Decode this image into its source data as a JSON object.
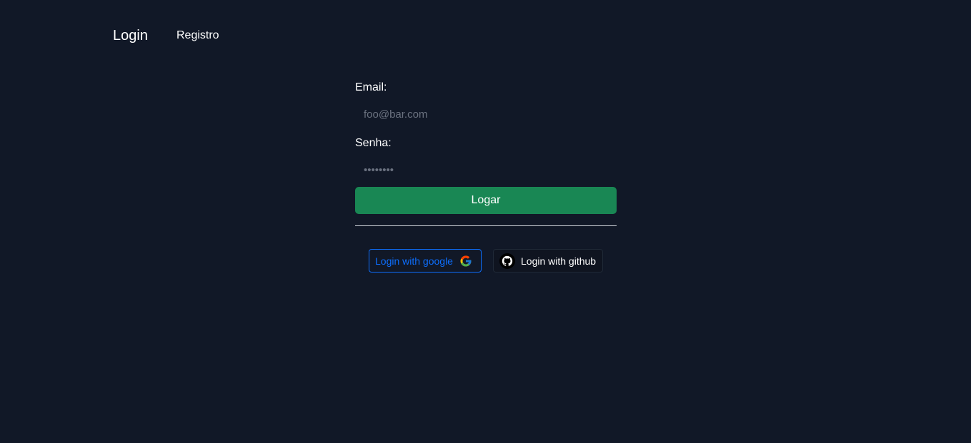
{
  "nav": {
    "login_label": "Login",
    "register_label": "Registro"
  },
  "form": {
    "email_label": "Email:",
    "email_placeholder": "foo@bar.com",
    "email_value": "",
    "password_label": "Senha:",
    "password_placeholder": "••••••••",
    "password_value": "",
    "submit_label": "Logar"
  },
  "social": {
    "google_label": "Login with google",
    "github_label": "Login with github"
  },
  "colors": {
    "background": "#111827",
    "submit": "#198754",
    "google_accent": "#0d6efd"
  },
  "icons": {
    "google": "google-icon",
    "github": "github-icon"
  }
}
